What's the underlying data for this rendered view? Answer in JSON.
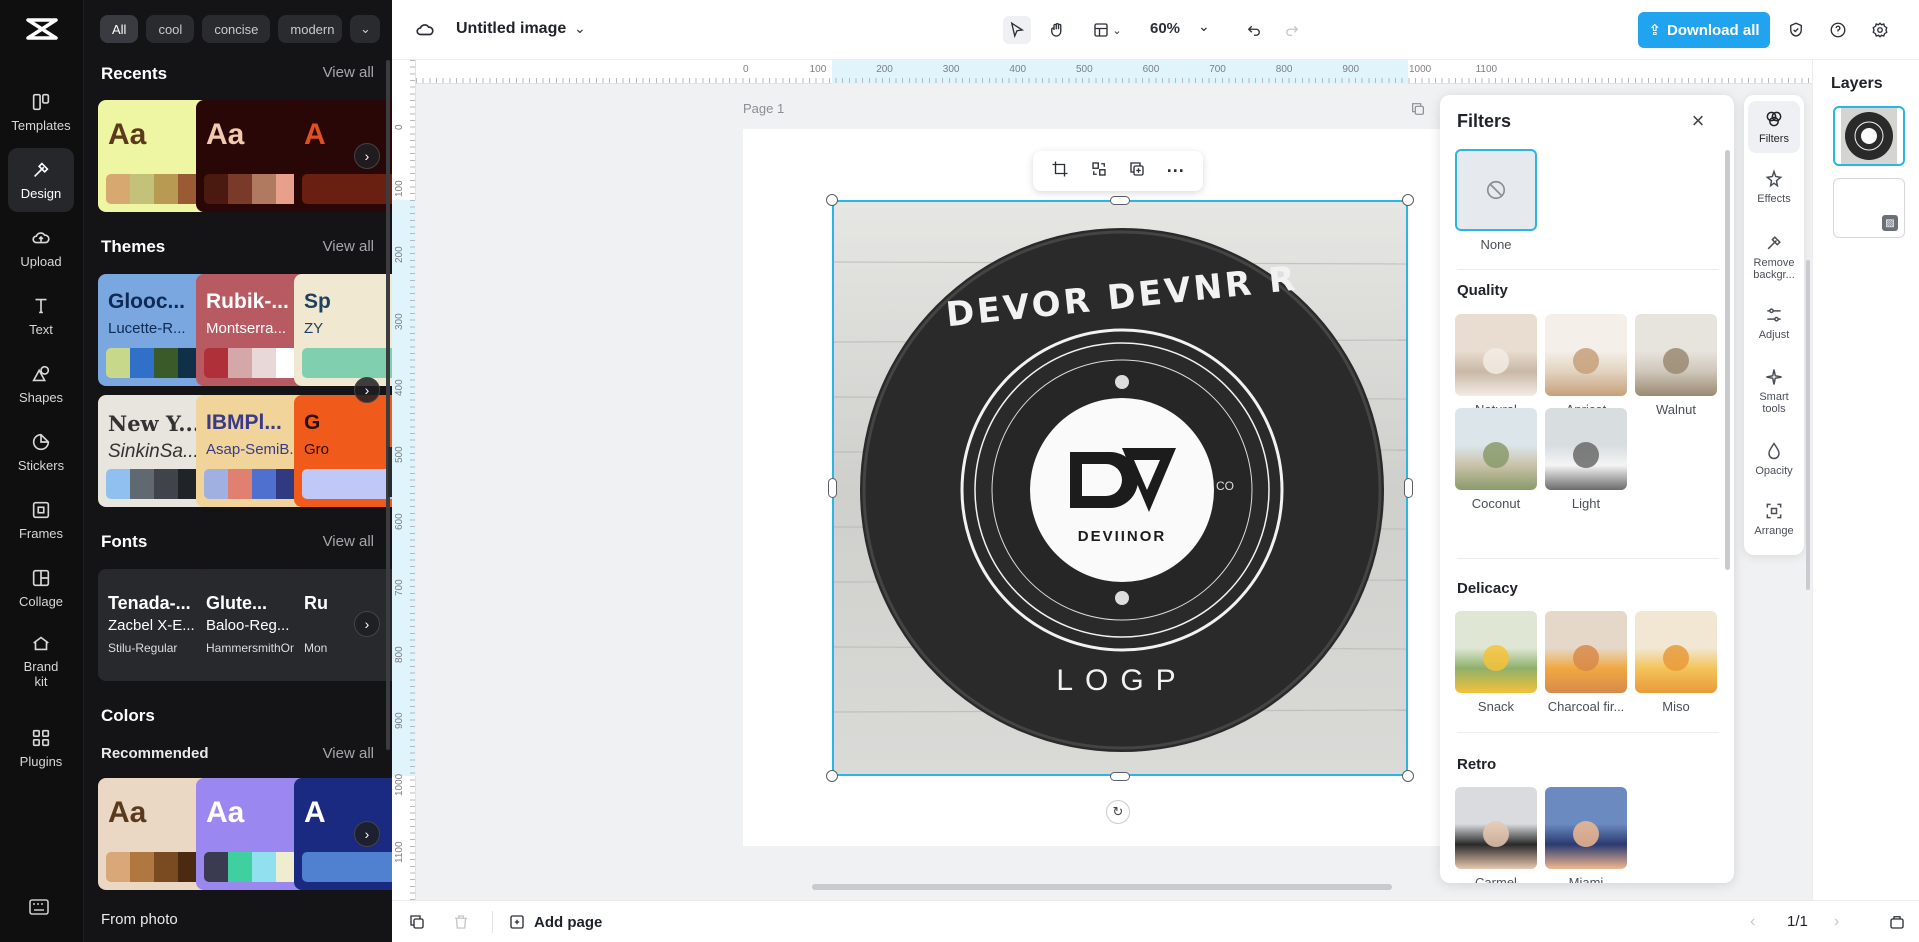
{
  "rail": {
    "items": [
      {
        "label": "Templates"
      },
      {
        "label": "Design"
      },
      {
        "label": "Upload"
      },
      {
        "label": "Text"
      },
      {
        "label": "Shapes"
      },
      {
        "label": "Stickers"
      },
      {
        "label": "Frames"
      },
      {
        "label": "Collage"
      },
      {
        "label": "Brand kit"
      },
      {
        "label": "Plugins"
      }
    ]
  },
  "design_panel": {
    "chips": [
      "All",
      "cool",
      "concise",
      "modern"
    ],
    "view_all": "View all",
    "recents": {
      "title": "Recents",
      "cards": [
        {
          "text": "Aa",
          "bg": "#eef6a4",
          "fg": "#5b3a1c",
          "swatches": [
            "#d8a871",
            "#c4c27a",
            "#b99a52",
            "#9a5a34"
          ]
        },
        {
          "text": "Aa",
          "bg": "#2a0707",
          "fg": "#f1c8b0",
          "swatches": [
            "#4a1a10",
            "#7a3a2a",
            "#b07a60",
            "#e8a08a"
          ]
        },
        {
          "text": "A",
          "bg": "#2a0707",
          "fg": "#e05020",
          "swatches": [
            "#6a2010"
          ]
        }
      ]
    },
    "themes": {
      "title": "Themes",
      "cards": [
        {
          "t1": "Glooc...",
          "t2": "Lucette-R...",
          "bg": "#7aa7e0",
          "fg": "#0e2a55",
          "swatches": [
            "#c8d88a",
            "#3070c8",
            "#3a5a2a",
            "#10304a"
          ]
        },
        {
          "t1": "Rubik-...",
          "t2": "Montserra...",
          "bg": "#b85a62",
          "fg": "#ffffff",
          "swatches": [
            "#b0303a",
            "#d4a8a8",
            "#e8d8d8",
            "#ffffff"
          ]
        },
        {
          "t1": "Sp",
          "t2": "ZY",
          "bg": "#f0e8d0",
          "fg": "#204060",
          "swatches": [
            "#80d0b0"
          ]
        },
        {
          "t1": "New Y...",
          "t2": "SinkinSa...",
          "bg": "#e8e4de",
          "fg": "#333333",
          "swatches": [
            "#90c0f0",
            "#606870",
            "#40444a",
            "#202428"
          ]
        },
        {
          "t1": "IBMPl...",
          "t2": "Asap-SemiB...",
          "bg": "#f0d49a",
          "fg": "#3a3a8a",
          "swatches": [
            "#a0b0e0",
            "#e08070",
            "#5070d0",
            "#303a80"
          ]
        },
        {
          "t1": "G",
          "t2": "Gro",
          "bg": "#f05a1a",
          "fg": "#2a0a00",
          "swatches": [
            "#c0c8f8"
          ]
        }
      ]
    },
    "fonts": {
      "title": "Fonts",
      "cards": [
        {
          "t1": "Tenada-...",
          "t2": "Zacbel X-E...",
          "t3": "Stilu-Regular"
        },
        {
          "t1": "Glute...",
          "t2": "Baloo-Reg...",
          "t3": "HammersmithOn..."
        },
        {
          "t1": "Ru",
          "t2": "",
          "t3": "Mon"
        }
      ]
    },
    "colors": {
      "title": "Colors",
      "subtitle": "Recommended",
      "cards": [
        {
          "text": "Aa",
          "bg": "#ead8c4",
          "fg": "#5a3a1c",
          "swatches": [
            "#d8a878",
            "#b07840",
            "#7a4a20",
            "#4a2a10"
          ]
        },
        {
          "text": "Aa",
          "bg": "#9a88f0",
          "fg": "#ffffff",
          "swatches": [
            "#3a3a50",
            "#40d0a0",
            "#90e0f0",
            "#f0ecd0"
          ]
        },
        {
          "text": "A",
          "bg": "#1a2a80",
          "fg": "#ffffff",
          "swatches": [
            "#5080d0"
          ]
        }
      ]
    },
    "from_photo": "From photo"
  },
  "topbar": {
    "doc_title": "Untitled image",
    "zoom": "60%",
    "download_label": "Download all"
  },
  "canvas": {
    "page_label": "Page 1",
    "ruler_h": [
      "0",
      "100",
      "200",
      "300",
      "400",
      "500",
      "600",
      "700",
      "800",
      "900",
      "1000",
      "1100"
    ],
    "ruler_v": [
      "0",
      "100",
      "200",
      "300",
      "400",
      "500",
      "600",
      "700",
      "800",
      "900",
      "1000",
      "1100"
    ],
    "logo_top_text": "DEVOR DEVNR R",
    "logo_mid_text": "DEVIINOR",
    "logo_bottom_text": "LOGP",
    "logo_side_text": "CO"
  },
  "bottombar": {
    "add_page": "Add page",
    "page_count": "1/1"
  },
  "filters": {
    "title": "Filters",
    "none_label": "None",
    "groups": [
      {
        "name": "Quality",
        "items": [
          "Natural",
          "Apricot",
          "Walnut",
          "Coconut",
          "Light"
        ]
      },
      {
        "name": "Delicacy",
        "items": [
          "Snack",
          "Charcoal fir...",
          "Miso"
        ]
      },
      {
        "name": "Retro",
        "items": [
          "Carmel",
          "Miami"
        ]
      }
    ]
  },
  "tools": {
    "items": [
      "Filters",
      "Effects",
      "Remove backgr...",
      "Adjust",
      "Smart tools",
      "Opacity",
      "Arrange"
    ]
  },
  "layers": {
    "title": "Layers"
  },
  "colors": {
    "accent": "#20a4ef",
    "selection": "#2bb4e6",
    "panel_dark": "#141416"
  }
}
